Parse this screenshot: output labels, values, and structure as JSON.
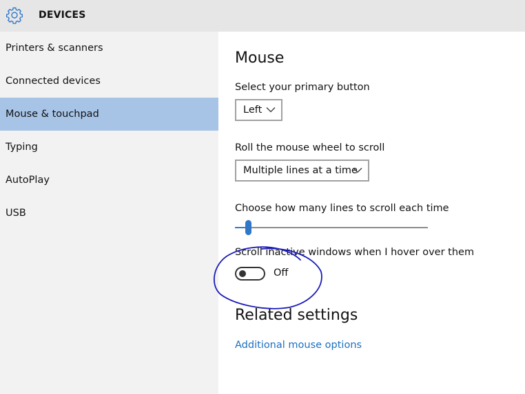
{
  "header": {
    "title": "DEVICES",
    "icon": "gear-icon",
    "accent": "#2f78c8"
  },
  "sidebar": {
    "selected_index": 2,
    "items": [
      {
        "label": "Printers & scanners"
      },
      {
        "label": "Connected devices"
      },
      {
        "label": "Mouse & touchpad"
      },
      {
        "label": "Typing"
      },
      {
        "label": "AutoPlay"
      },
      {
        "label": "USB"
      }
    ]
  },
  "main": {
    "heading": "Mouse",
    "primary_button": {
      "label": "Select your primary button",
      "value": "Left"
    },
    "wheel_scroll": {
      "label": "Roll the mouse wheel to scroll",
      "value": "Multiple lines at a time"
    },
    "lines_slider": {
      "label": "Choose how many lines to scroll each time"
    },
    "inactive_scroll": {
      "label": "Scroll inactive windows when I hover over them",
      "state_text": "Off"
    },
    "related": {
      "heading": "Related settings",
      "link": "Additional mouse options"
    }
  },
  "colors": {
    "selected_nav": "#a7c4e6",
    "link": "#1a6fc0",
    "annotation_ink": "#1a1ab8"
  }
}
